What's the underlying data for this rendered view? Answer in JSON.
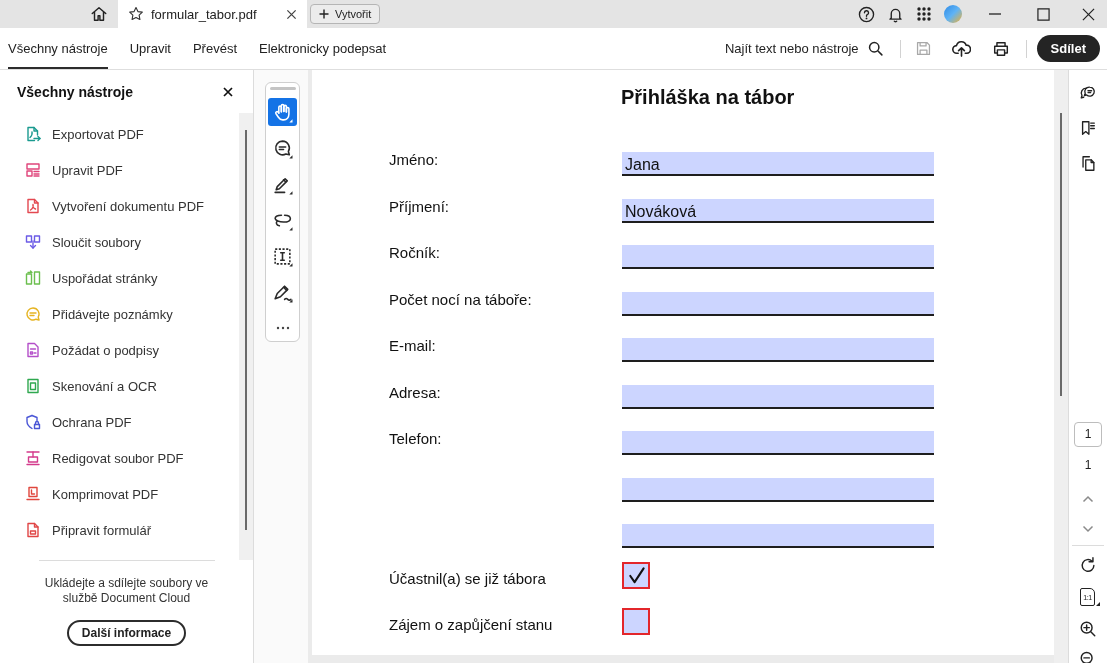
{
  "tab_bar": {
    "tabs": [
      {
        "title": "formular_tabor.pdf",
        "selected": true
      }
    ],
    "new_button": "Vytvořit"
  },
  "command_bar": {
    "tabs": [
      {
        "label": "Všechny nástroje",
        "selected": true
      },
      {
        "label": "Upravit",
        "selected": false
      },
      {
        "label": "Převést",
        "selected": false
      },
      {
        "label": "Elektronicky podepsat",
        "selected": false
      }
    ],
    "find_label": "Najít text nebo nástroje",
    "save_disabled": true,
    "share_button": "Sdílet"
  },
  "sidebar": {
    "title": "Všechny nástroje",
    "items": [
      "Exportovat PDF",
      "Upravit PDF",
      "Vytvoření dokumentu PDF",
      "Sloučit soubory",
      "Uspořádat stránky",
      "Přidávejte poznámky",
      "Požádat o podpisy",
      "Skenování a OCR",
      "Ochrana PDF",
      "Redigovat soubor PDF",
      "Komprimovat PDF",
      "Připravit formulář"
    ],
    "promo_text": "Ukládejte a sdílejte soubory ve službě Document Cloud",
    "promo_button": "Další informace"
  },
  "toolbar": {
    "tools": [
      {
        "selected": true
      },
      {
        "selected": false
      },
      {
        "selected": false
      },
      {
        "selected": false
      },
      {
        "selected": false
      },
      {
        "selected": false
      }
    ]
  },
  "document": {
    "title": "Přihláška na tábor",
    "fields": [
      {
        "label": "Jméno:",
        "kind": "text",
        "value": "Jana"
      },
      {
        "label": "Příjmení:",
        "kind": "text",
        "value": "Nováková"
      },
      {
        "label": "Ročník:",
        "kind": "text"
      },
      {
        "label": "Počet nocí na táboře:",
        "kind": "text"
      },
      {
        "label": "E-mail:",
        "kind": "text"
      },
      {
        "label": "Adresa:",
        "kind": "text"
      },
      {
        "label": "Telefon:",
        "kind": "text"
      },
      {
        "kind": "text"
      },
      {
        "kind": "text"
      },
      {
        "label": "Účastnil(a) se již tábora",
        "kind": "checkbox",
        "checked": true
      },
      {
        "label": "Zájem o zapůjčení stanu",
        "kind": "checkbox",
        "checked": false
      }
    ]
  },
  "page_nav": {
    "current_page": "1",
    "page_count": "1",
    "actual_size_label": "1:1"
  }
}
